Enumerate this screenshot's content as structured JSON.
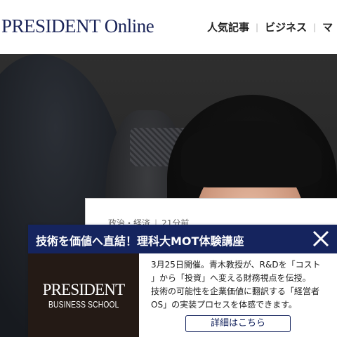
{
  "header": {
    "logo": "PRESIDENT Online",
    "nav": [
      "人気記事",
      "ビジネス",
      "マ"
    ]
  },
  "article": {
    "category": "政治・経済",
    "time": "21分前"
  },
  "banner": {
    "title": "技術を価値へ直結！理科大MOT体験講座",
    "logo_name": "PRESIDENT",
    "logo_sub": "BUSINESS SCHOOL",
    "lines": [
      "3月25日開催。青木教授が、R&Dを「コスト",
      "」から「投資」へ変える財務視点を伝授。",
      "技術の可能性を企業価値に翻訳する「経営者",
      "OS」の実装プロセスを体感できます。"
    ],
    "button": "詳細はこちら",
    "close_icon": "close-icon"
  },
  "colors": {
    "brand_navy": "#15245e",
    "logo_navy": "#1b2559",
    "school_bg": "#241a15"
  }
}
